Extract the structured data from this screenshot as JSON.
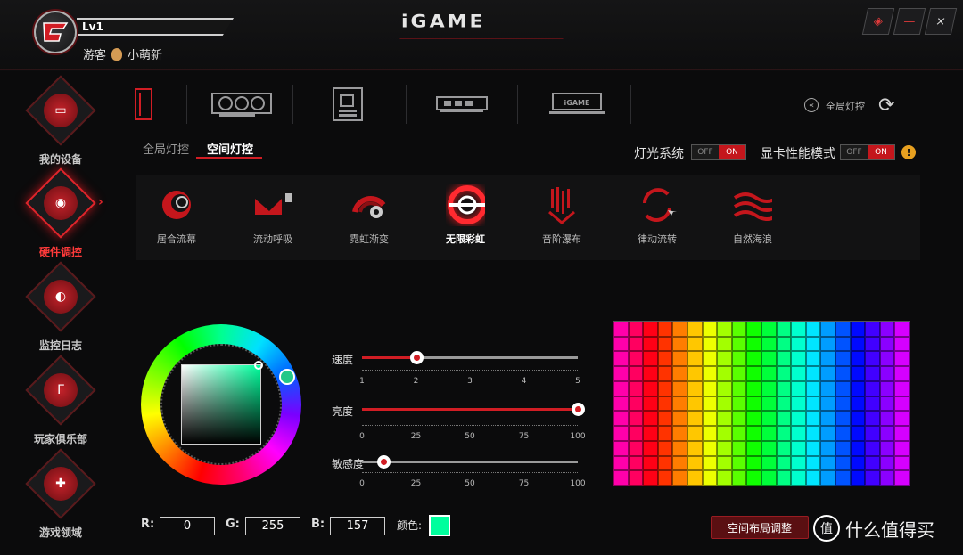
{
  "header": {
    "level": "Lv1",
    "user_type": "游客",
    "username": "小萌新",
    "logo": "iGAME"
  },
  "window_controls": [
    "skin-icon",
    "minimize-icon",
    "close-icon"
  ],
  "sidebar": {
    "items": [
      {
        "label": "我的设备",
        "icon": "monitor-icon",
        "active": false
      },
      {
        "label": "硬件调控",
        "icon": "control-pad-icon",
        "active": true
      },
      {
        "label": "监控日志",
        "icon": "gauge-icon",
        "active": false
      },
      {
        "label": "玩家俱乐部",
        "icon": "igame-club-icon",
        "active": false
      },
      {
        "label": "游戏领域",
        "icon": "gamepad-icon",
        "active": false
      }
    ]
  },
  "devices": [
    "pc-case-icon",
    "graphics-card-icon",
    "motherboard-icon",
    "memory-icon",
    "monitor-icon"
  ],
  "global_light_link": "全局灯控",
  "tabs": [
    {
      "label": "全局灯控",
      "active": false
    },
    {
      "label": "空间灯控",
      "active": true
    }
  ],
  "toggles": {
    "light_system": {
      "label": "灯光系统",
      "off": "OFF",
      "on": "ON",
      "state": "ON"
    },
    "gpu_mode": {
      "label": "显卡性能模式",
      "off": "OFF",
      "on": "ON",
      "state": "ON"
    }
  },
  "warning_icon": "!",
  "modes": [
    {
      "label": "居合流幕",
      "icon": "swirl-icon"
    },
    {
      "label": "流动呼吸",
      "icon": "wave-flow-icon"
    },
    {
      "label": "霓虹渐变",
      "icon": "neon-fan-icon"
    },
    {
      "label": "无限彩虹",
      "icon": "rainbow-ring-icon",
      "active": true
    },
    {
      "label": "音阶瀑布",
      "icon": "waterfall-icon"
    },
    {
      "label": "律动流转",
      "icon": "rotation-icon"
    },
    {
      "label": "自然海浪",
      "icon": "sea-wave-icon"
    }
  ],
  "sliders": {
    "speed": {
      "label": "速度",
      "ticks": [
        "1",
        "2",
        "3",
        "4",
        "5"
      ],
      "value": 2,
      "min": 1,
      "max": 5
    },
    "brightness": {
      "label": "亮度",
      "ticks": [
        "0",
        "25",
        "50",
        "75",
        "100"
      ],
      "value": 100,
      "min": 0,
      "max": 100
    },
    "sensitivity": {
      "label": "敏感度",
      "ticks": [
        "0",
        "25",
        "50",
        "75",
        "100"
      ],
      "value": 10,
      "min": 0,
      "max": 100
    }
  },
  "color": {
    "r_label": "R:",
    "g_label": "G:",
    "b_label": "B:",
    "r": "0",
    "g": "255",
    "b": "157",
    "swatch_label": "颜色:",
    "hex": "#00ff9d"
  },
  "layout_button": "空间布局调整",
  "watermark": "什么值得买"
}
